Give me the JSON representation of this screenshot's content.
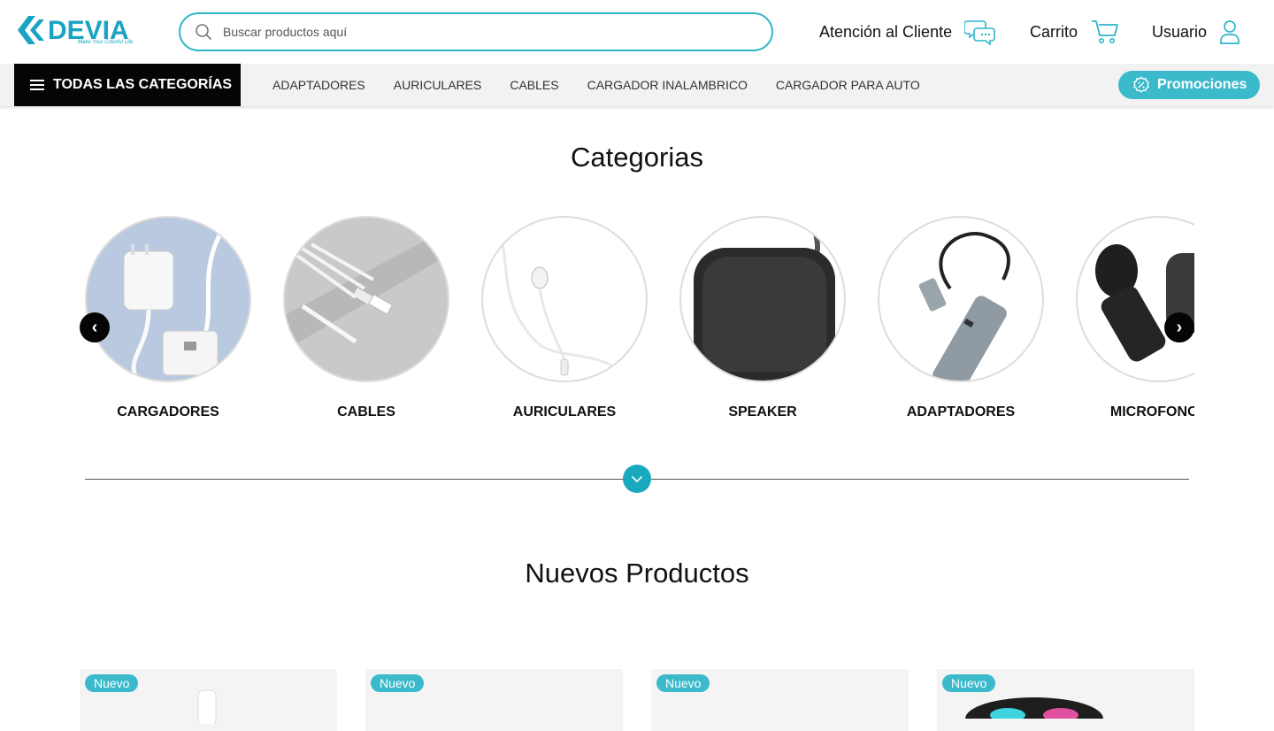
{
  "header": {
    "logo_text": "DEVIA",
    "logo_tagline": "Make Your Colorful Life",
    "search_placeholder": "Buscar productos aquí",
    "customer_service": "Atención al Cliente",
    "cart": "Carrito",
    "user": "Usuario"
  },
  "nav": {
    "all_categories": "TODAS LAS CATEGORÍAS",
    "links": [
      "ADAPTADORES",
      "AURICULARES",
      "CABLES",
      "CARGADOR INALAMBRICO",
      "CARGADOR PARA AUTO"
    ],
    "promotions": "Promociones"
  },
  "categories": {
    "title": "Categorias",
    "items": [
      {
        "label": "CARGADORES",
        "image": "charger-image"
      },
      {
        "label": "CABLES",
        "image": "cables-image"
      },
      {
        "label": "AURICULARES",
        "image": "earphones-image"
      },
      {
        "label": "SPEAKER",
        "image": "speaker-image"
      },
      {
        "label": "ADAPTADORES",
        "image": "adapter-hub-image"
      },
      {
        "label": "MICROFONOS",
        "image": "microphone-image"
      }
    ]
  },
  "new_products": {
    "title": "Nuevos Productos",
    "cards": [
      {
        "badge": "Nuevo"
      },
      {
        "badge": "Nuevo"
      },
      {
        "badge": "Nuevo"
      },
      {
        "badge": "Nuevo"
      }
    ]
  },
  "colors": {
    "accent": "#3bbacc",
    "brand": "#1aa3c4",
    "nav_dark": "#050505"
  }
}
